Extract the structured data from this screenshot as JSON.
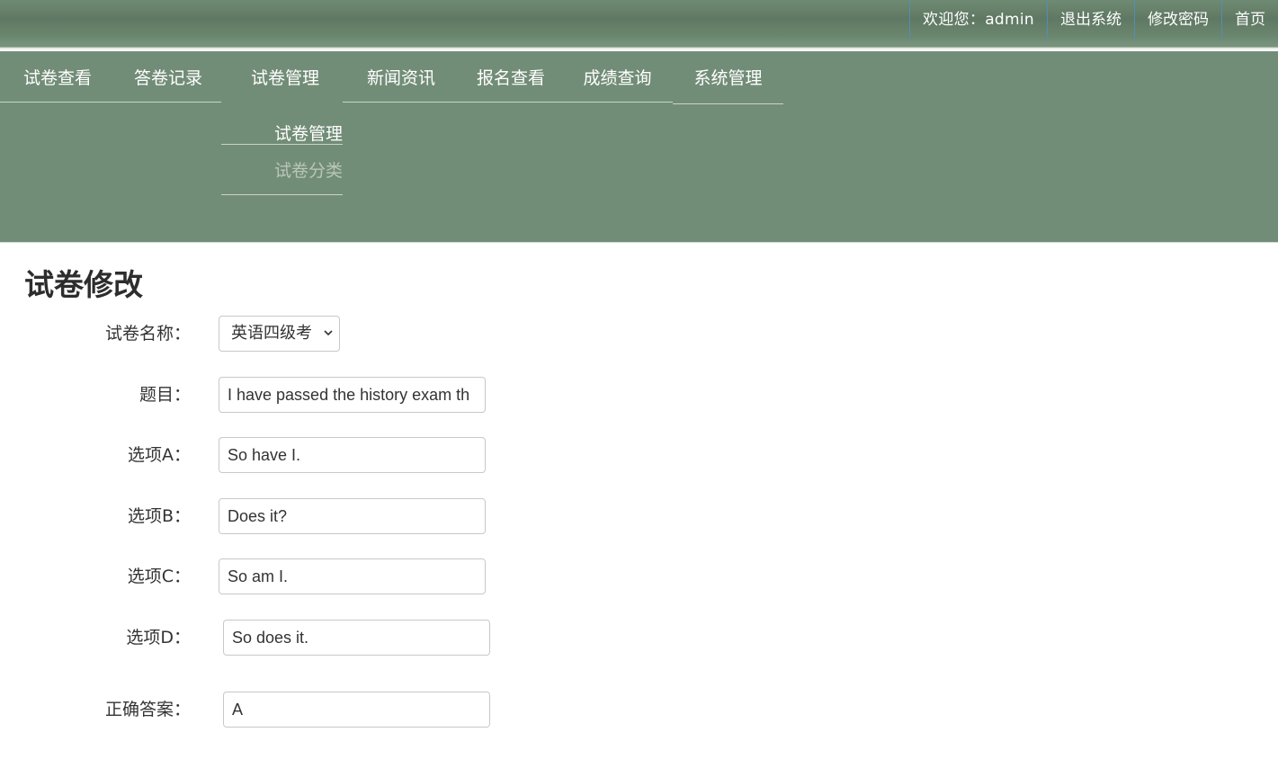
{
  "header": {
    "welcome_label": "欢迎您：",
    "username": "admin",
    "links": [
      {
        "label": "退出系统"
      },
      {
        "label": "修改密码"
      },
      {
        "label": "首页"
      }
    ]
  },
  "nav": {
    "items": [
      {
        "label": "试卷查看"
      },
      {
        "label": "答卷记录"
      },
      {
        "label": "试卷管理"
      },
      {
        "label": "新闻资讯"
      },
      {
        "label": "报名查看"
      },
      {
        "label": "成绩查询"
      },
      {
        "label": "系统管理"
      }
    ],
    "submenu": {
      "items": [
        {
          "label": "试卷管理"
        },
        {
          "label": "试卷分类"
        }
      ]
    }
  },
  "page": {
    "title": "试卷修改"
  },
  "form": {
    "paper_name": {
      "label": "试卷名称：",
      "value": "英语四级考"
    },
    "question": {
      "label": "题目：",
      "value": "I have passed the history exam th"
    },
    "option_a": {
      "label": "选项A：",
      "value": "So have I."
    },
    "option_b": {
      "label": "选项B：",
      "value": "Does it?"
    },
    "option_c": {
      "label": "选项C：",
      "value": "So am I."
    },
    "option_d": {
      "label": "选项D：",
      "value": "So does it."
    },
    "answer": {
      "label": "正确答案：",
      "value": "A"
    }
  },
  "icons": {
    "select_arrow": "chevron-down-icon"
  },
  "colors": {
    "header_bg": "#637d67",
    "nav_bg": "#728d77",
    "link_divider": "#4f8fb5",
    "submenu_inactive": "#b9c6bb"
  }
}
